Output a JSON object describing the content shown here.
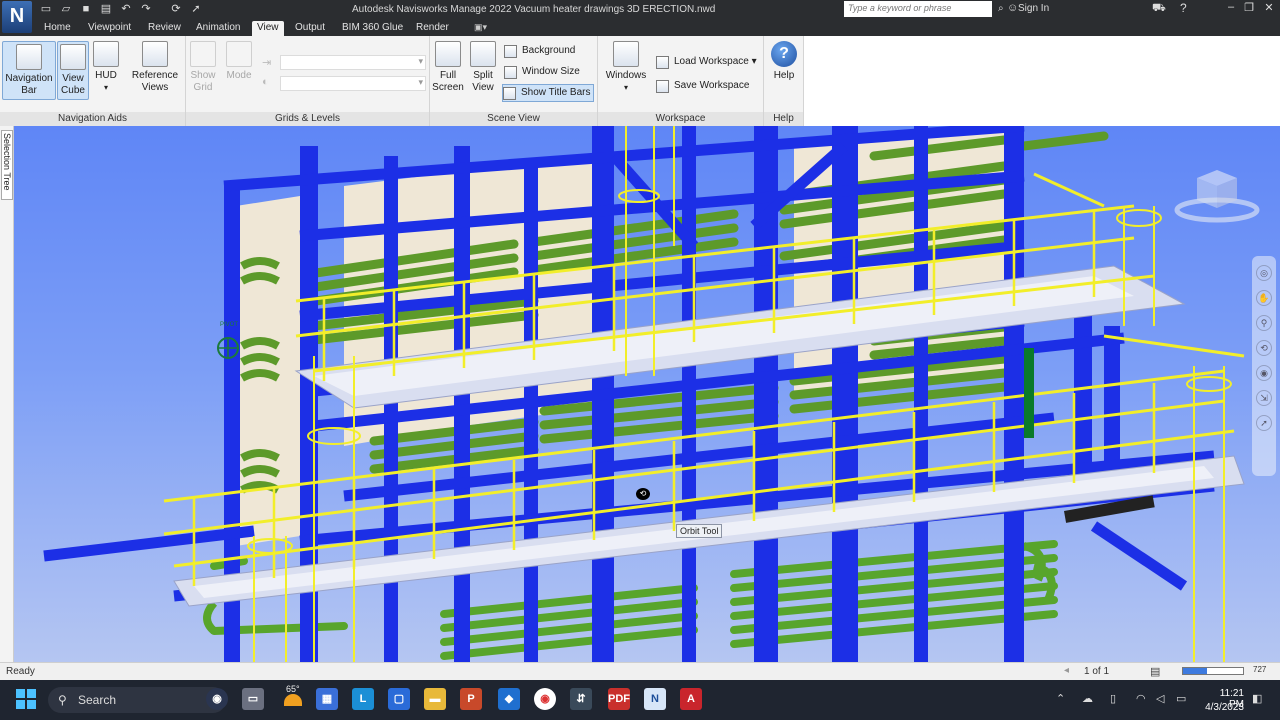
{
  "app": {
    "logo_letter": "N",
    "window_title": "Autodesk Navisworks Manage 2022   Vacuum heater drawings 3D ERECTION.nwd",
    "search_placeholder": "Type a keyword or phrase",
    "signin_label": "Sign In"
  },
  "ribbon_tabs": [
    {
      "label": "Home"
    },
    {
      "label": "Viewpoint"
    },
    {
      "label": "Review"
    },
    {
      "label": "Animation"
    },
    {
      "label": "View",
      "active": true
    },
    {
      "label": "Output"
    },
    {
      "label": "BIM 360 Glue"
    },
    {
      "label": "Render"
    }
  ],
  "ribbon": {
    "navigation_aids": {
      "title": "Navigation Aids",
      "navigation_bar": "Navigation Bar",
      "view_cube": "View Cube",
      "hud": "HUD",
      "reference_views": "Reference Views"
    },
    "grids_levels": {
      "title": "Grids & Levels",
      "show_grid": "Show Grid",
      "mode": "Mode"
    },
    "scene_view": {
      "title": "Scene View",
      "full_screen": "Full Screen",
      "split_view": "Split View",
      "background": "Background",
      "window_size": "Window Size",
      "show_title_bars": "Show Title Bars"
    },
    "workspace": {
      "title": "Workspace",
      "windows": "Windows",
      "load_workspace": "Load Workspace",
      "save_workspace": "Save Workspace"
    },
    "help": {
      "title": "Help",
      "help": "Help"
    }
  },
  "side_tab": {
    "label": "Selection Tree"
  },
  "viewport": {
    "tooltip": "Orbit Tool",
    "pivot_label": "PIVOT"
  },
  "status": {
    "ready": "Ready",
    "page": "1 of 1",
    "memory": "727"
  },
  "taskbar": {
    "search_label": "Search",
    "weather": "65°",
    "time": "11:21 PM",
    "date": "4/3/2023"
  },
  "colors": {
    "steel": "#1c2fe6",
    "coils": "#6aa431",
    "railing": "#f2ee2a",
    "sky": "#6d92f6"
  }
}
